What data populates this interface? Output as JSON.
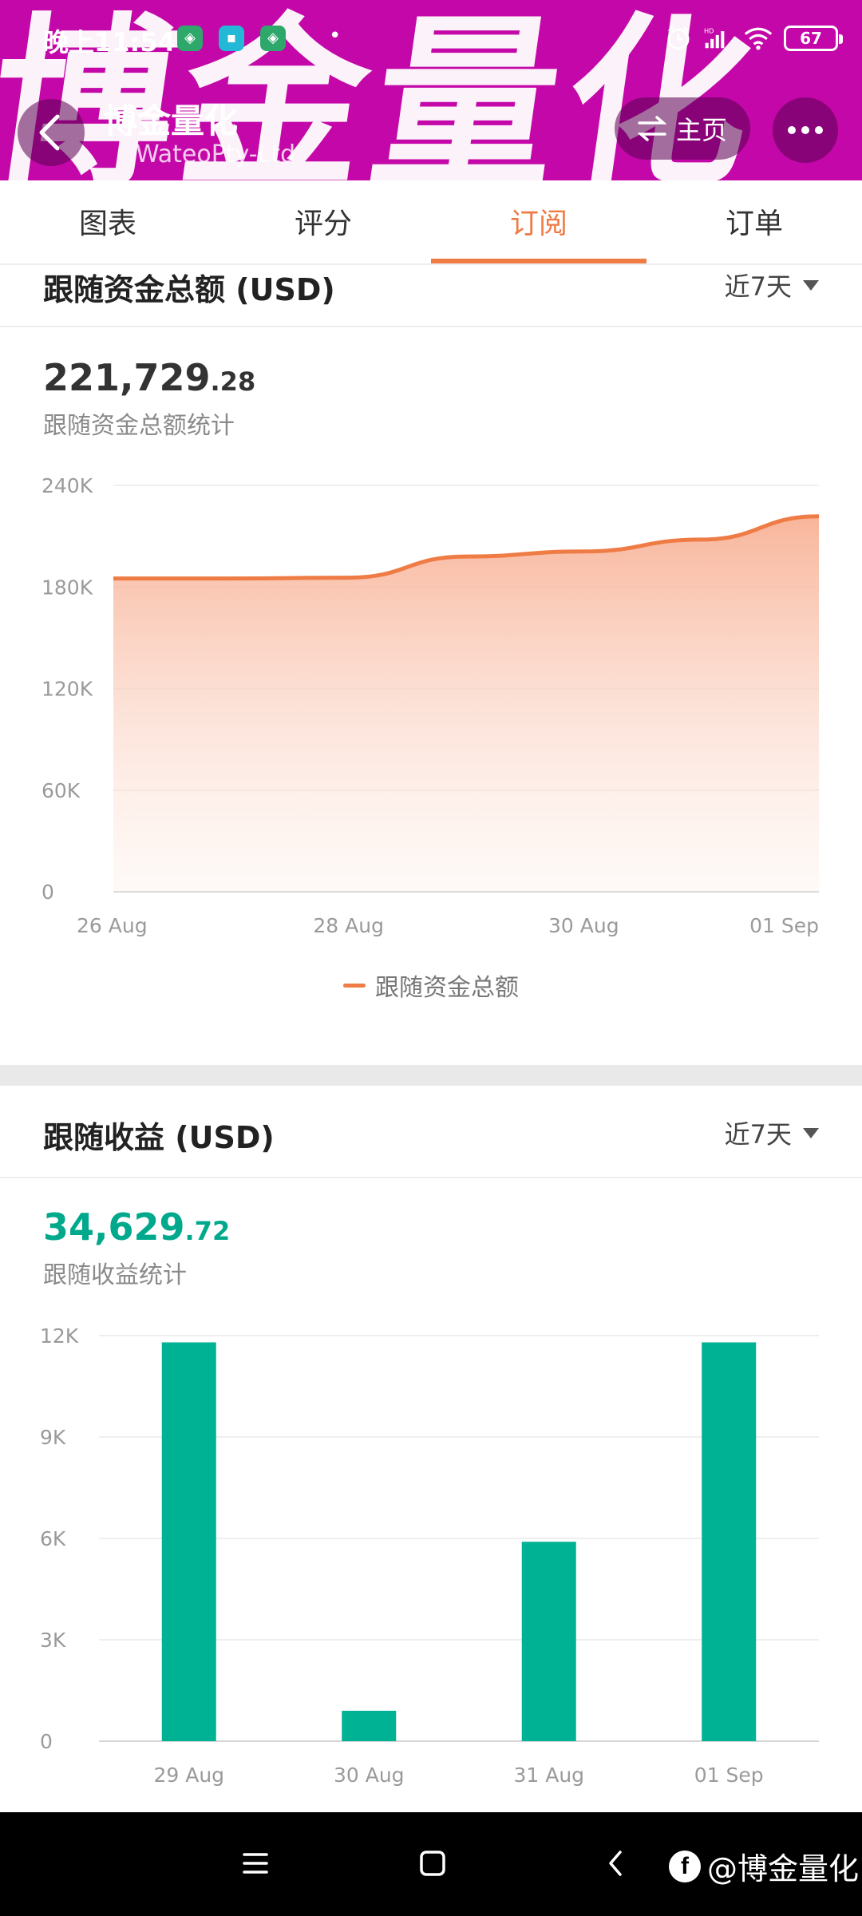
{
  "status_bar": {
    "time": "晚上11:54",
    "notification_icons": [
      "shield-icon",
      "message-icon",
      "shield-icon"
    ],
    "battery_level": "67",
    "hd_label": "HD"
  },
  "header": {
    "watermark": "博金量化",
    "title": "博金量化",
    "subtitle": "WateoPty-Ltd",
    "home_label": "主页"
  },
  "tabs": [
    {
      "label": "图表",
      "active": false
    },
    {
      "label": "评分",
      "active": false
    },
    {
      "label": "订阅",
      "active": true
    },
    {
      "label": "订单",
      "active": false
    }
  ],
  "follow_funds": {
    "title": "跟随资金总额 (USD)",
    "range": "近7天",
    "value_int": "221,729",
    "value_dec": ".28",
    "caption": "跟随资金总额统计",
    "legend": "跟随资金总额",
    "color": "#ef7b45"
  },
  "follow_profit": {
    "title": "跟随收益 (USD)",
    "range": "近7天",
    "value_int": "34,629",
    "value_dec": ".72",
    "caption": "跟随收益统计",
    "color": "#00b294"
  },
  "chart_data": [
    {
      "type": "area",
      "x": [
        "26 Aug",
        "27 Aug",
        "28 Aug",
        "29 Aug",
        "30 Aug",
        "31 Aug",
        "01 Sep"
      ],
      "xticks": [
        "26 Aug",
        "28 Aug",
        "30 Aug",
        "01 Sep"
      ],
      "series": [
        {
          "name": "跟随资金总额",
          "values": [
            185000,
            185000,
            185500,
            198000,
            201000,
            208000,
            221729
          ]
        }
      ],
      "yticks": [
        "0",
        "60K",
        "120K",
        "180K",
        "240K"
      ],
      "ylim": [
        0,
        240000
      ],
      "grid": true,
      "legend": "bottom-center"
    },
    {
      "type": "bar",
      "categories": [
        "29 Aug",
        "30 Aug",
        "31 Aug",
        "01 Sep"
      ],
      "values": [
        11800,
        900,
        5900,
        11800
      ],
      "yticks": [
        "0",
        "3K",
        "6K",
        "9K",
        "12K"
      ],
      "ylim": [
        0,
        12000
      ],
      "grid": true
    }
  ],
  "navbar": {
    "brand": "@博金量化"
  }
}
